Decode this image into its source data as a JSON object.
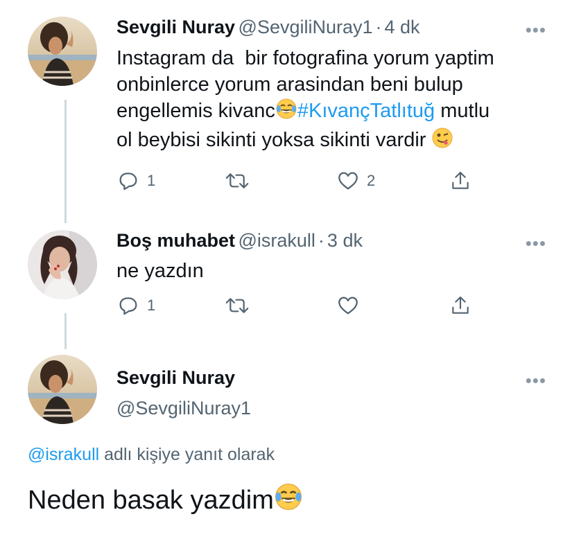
{
  "tweets": [
    {
      "name": "Sevgili Nuray",
      "handle": "@SevgiliNuray1",
      "sep": "·",
      "time": "4 dk",
      "line1": "Instagram da  bir fotografina yorum yaptim",
      "line2": "onbinlerce yorum arasindan beni bulup",
      "line3_pre": "engellemis kivanc",
      "hashtag": "#KıvançTatlıtuğ",
      "line3_post": " mutlu",
      "line4": "ol beybisi sikinti yoksa sikinti vardir ",
      "emoji_laugh": "face-with-tears-of-joy",
      "emoji_wink": "winking-face-with-tongue",
      "reply_count": "1",
      "retweet_count": "",
      "like_count": "2"
    },
    {
      "name": "Boş muhabet",
      "handle": "@israkull",
      "sep": "·",
      "time": "3 dk",
      "text": "ne yazdın",
      "reply_count": "1",
      "retweet_count": "",
      "like_count": ""
    },
    {
      "name": "Sevgili Nuray",
      "handle": "@SevgiliNuray1",
      "reply_to_handle": "@israkull",
      "reply_to_suffix": " adlı kişiye yanıt olarak",
      "text": "Neden basak yazdim",
      "emoji": "face-with-tears-of-joy"
    }
  ],
  "more_label": "•••",
  "colors": {
    "accent": "#1d9bf0",
    "muted": "#536471",
    "line": "#cfd9de"
  }
}
